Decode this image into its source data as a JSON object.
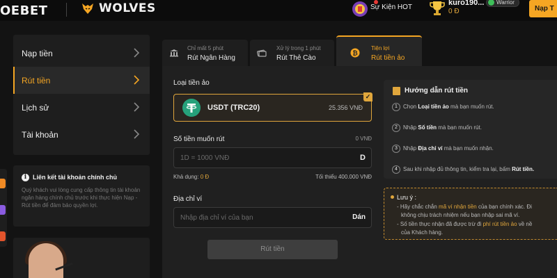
{
  "header": {
    "logo": "OEBET",
    "partner": "WOLVES",
    "hot_event": "Sự Kiện HOT",
    "username": "kuro190...",
    "badge": "Warrior",
    "balance": "0 Đ",
    "deposit_button": "Nạp T"
  },
  "sidebar": {
    "items": [
      {
        "label": "Nạp tiền",
        "active": false
      },
      {
        "label": "Rút tiền",
        "active": true
      },
      {
        "label": "Lịch sử",
        "active": false
      },
      {
        "label": "Tài khoản",
        "active": false
      }
    ]
  },
  "infobox": {
    "title": "Liên kết tài khoản chính chủ",
    "body": "Quý khách vui lòng cung cấp thông tin tài khoản ngân hàng chính chủ trước khi thực hiện Nạp - Rút tiền để đảm bảo quyền lợi."
  },
  "tabs": [
    {
      "sub": "Chỉ mất 5 phút",
      "main": "Rút Ngân Hàng",
      "icon": "bank-icon",
      "active": false
    },
    {
      "sub": "Xử lý trong 1 phút",
      "main": "Rút Thẻ Cào",
      "icon": "card-icon",
      "active": false
    },
    {
      "sub": "Tiện lợi",
      "main": "Rút tiền ảo",
      "icon": "bitcoin-icon",
      "active": true
    }
  ],
  "form": {
    "crypto_label": "Loại tiền ảo",
    "crypto_name": "USDT (TRC20)",
    "crypto_rate": "25.356 VNĐ",
    "amount_label": "Số tiền muốn rút",
    "amount_value": "0 VNĐ",
    "amount_placeholder": "1D = 1000 VNĐ",
    "amount_suffix": "D",
    "available_label": "Khả dụng:",
    "available_value": "0 Đ",
    "minimum": "Tối thiểu 400.000 VNĐ",
    "wallet_label": "Địa chỉ ví",
    "wallet_placeholder": "Nhập địa chỉ ví của bạn",
    "paste_button": "Dán",
    "submit_button": "Rút tiền"
  },
  "guide": {
    "title": "Hướng dẫn rút tiền",
    "steps": [
      {
        "num": "1",
        "pre": "Chọn ",
        "bold": "Loại tiền ảo",
        "post": " mà bạn muốn rút."
      },
      {
        "num": "2",
        "pre": "Nhập ",
        "bold": "Số tiền",
        "post": " mà bạn muốn rút."
      },
      {
        "num": "3",
        "pre": "Nhập ",
        "bold": "Địa chỉ ví",
        "post": " mà bạn muốn nhận."
      },
      {
        "num": "4",
        "pre": "Sau khi nhập đủ thông tin, kiểm tra lại, bấm ",
        "bold": "Rút tiền.",
        "post": ""
      }
    ]
  },
  "note": {
    "title": "Lưu ý :",
    "line1_pre": "- Hãy chắc chắn ",
    "line1_hl": "mã ví nhận tiền",
    "line1_post": " của bạn chính xác. Đi",
    "line2": "không chịu trách nhiệm nếu bạn nhập sai mã ví.",
    "line3_pre": "- Số tiền thực nhận đã được trừ đi ",
    "line3_hl": "phí rút tiền ảo",
    "line3_post": " về nề",
    "line4": "của Khách hàng."
  },
  "colors": {
    "accent": "#f5a623",
    "accent_gold": "#e0a63c",
    "background": "#131313",
    "panel": "#202020",
    "tether": "#26a17b"
  }
}
